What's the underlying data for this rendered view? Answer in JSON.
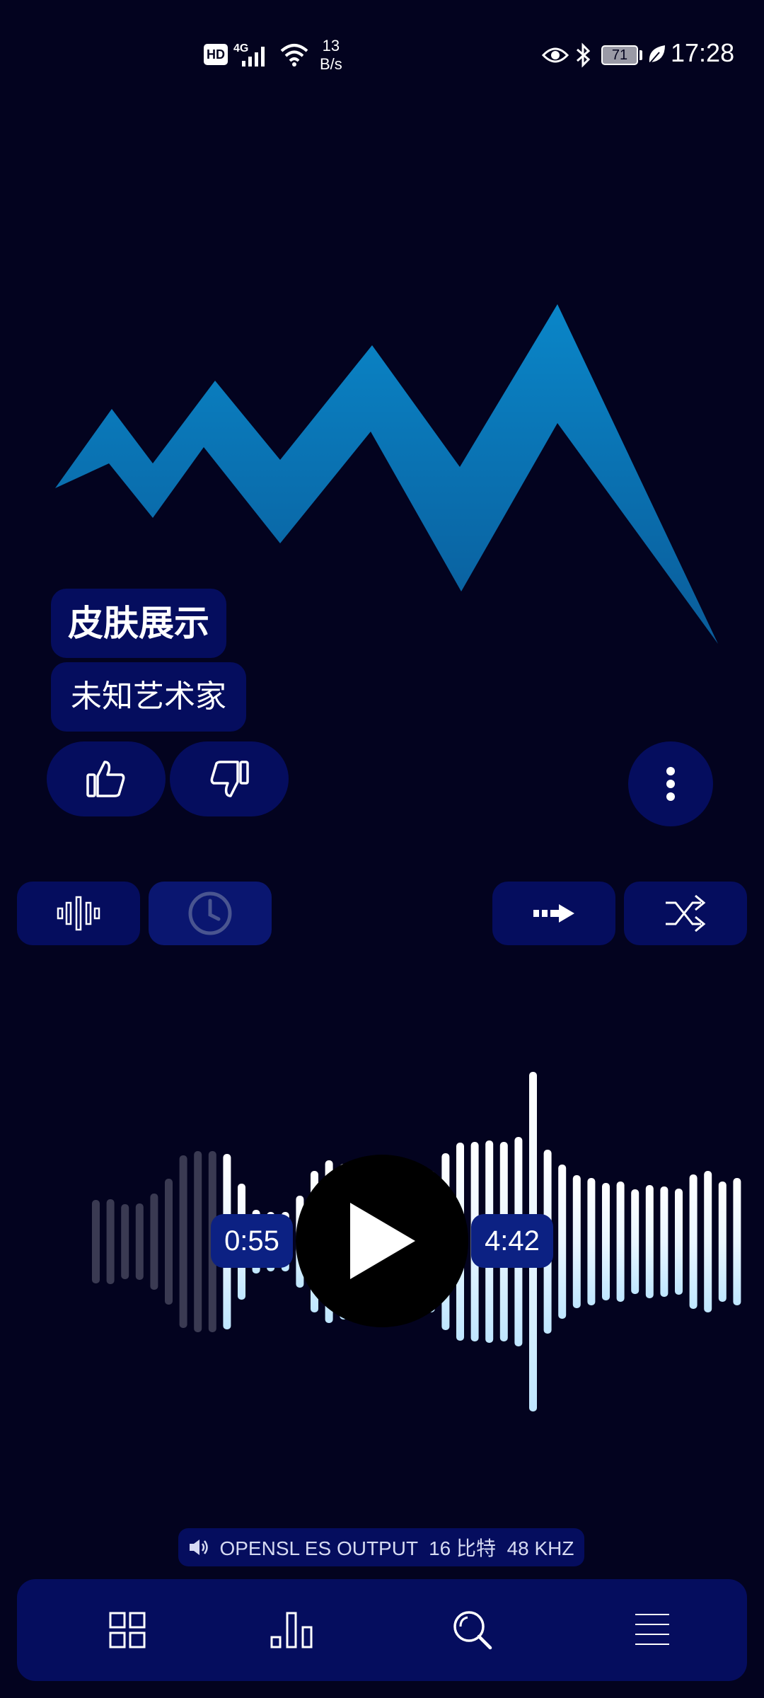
{
  "status_bar": {
    "hd": "HD",
    "network": "4G",
    "speed_value": "13",
    "speed_unit": "B/s",
    "battery": "71",
    "time": "17:28"
  },
  "track": {
    "title": "皮肤展示",
    "artist": "未知艺术家"
  },
  "player": {
    "elapsed": "0:55",
    "duration": "4:42",
    "progress": 0.195
  },
  "output": {
    "label": "OPENSL ES OUTPUT  16 比特  48 KHZ"
  },
  "colors": {
    "background": "#03031f",
    "pill": "#050d5e",
    "logo_top": "#0a86c8",
    "logo_bottom": "#0a5c9a",
    "wave_played": "#3a3a52",
    "wave_upcoming": "#bfe6ff"
  },
  "icons": {
    "like": "thumbs-up-icon",
    "dislike": "thumbs-down-icon",
    "more": "more-vertical-icon",
    "waveform": "waveform-icon",
    "sleep_timer": "clock-icon",
    "repeat": "arrow-right-icon",
    "shuffle": "shuffle-icon",
    "play": "play-icon",
    "speaker": "speaker-icon",
    "nav": [
      "grid-icon",
      "bar-chart-icon",
      "search-icon",
      "menu-icon"
    ]
  }
}
